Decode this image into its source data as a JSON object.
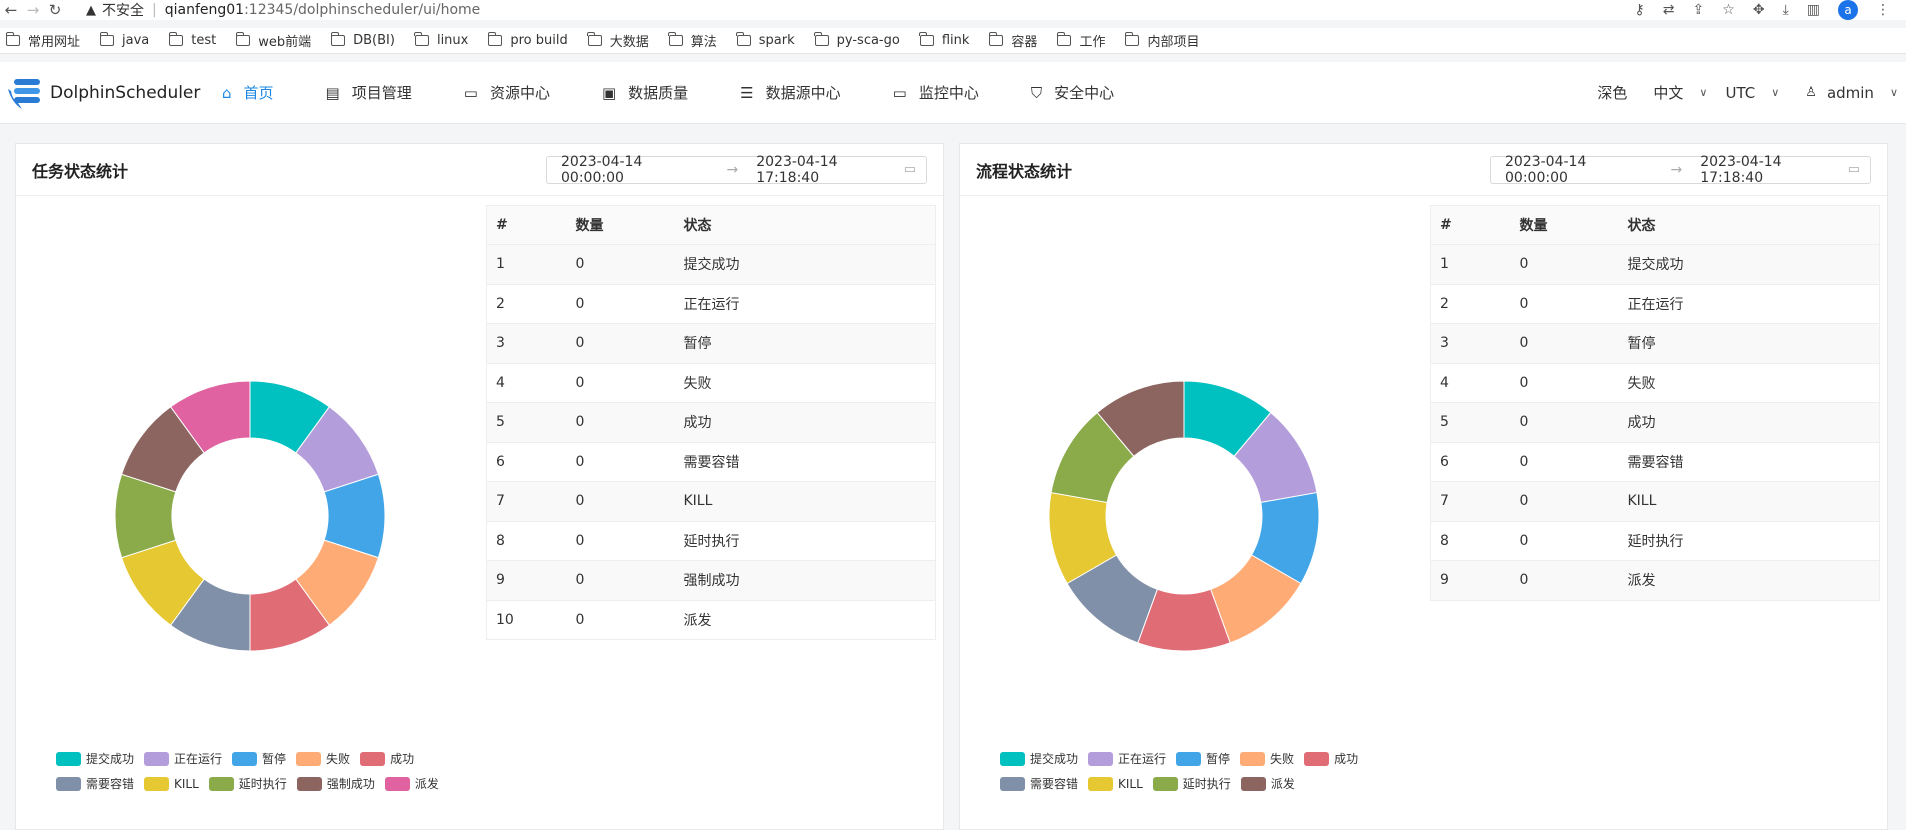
{
  "browser": {
    "security_label": "不安全",
    "url_host": "qianfeng01",
    "url_rest": ":12345/dolphinscheduler/ui/home",
    "profile_initial": "a"
  },
  "bookmarks": [
    "常用网址",
    "java",
    "test",
    "web前端",
    "DB(BI)",
    "linux",
    "pro build",
    "大数据",
    "算法",
    "spark",
    "py-sca-go",
    "flink",
    "容器",
    "工作",
    "内部项目"
  ],
  "app": {
    "name": "DolphinScheduler",
    "menu": [
      {
        "label": "首页",
        "icon": "home-icon"
      },
      {
        "label": "项目管理",
        "icon": "project-icon"
      },
      {
        "label": "资源中心",
        "icon": "folder-icon"
      },
      {
        "label": "数据质量",
        "icon": "data-quality-icon"
      },
      {
        "label": "数据源中心",
        "icon": "datasource-icon"
      },
      {
        "label": "监控中心",
        "icon": "monitor-icon"
      },
      {
        "label": "安全中心",
        "icon": "shield-icon"
      }
    ],
    "theme_label": "深色",
    "language": "中文",
    "timezone": "UTC",
    "user": "admin"
  },
  "task_panel": {
    "title": "任务状态统计",
    "start": "2023-04-14 00:00:00",
    "end": "2023-04-14 17:18:40",
    "headers": [
      "#",
      "数量",
      "状态"
    ],
    "rows": [
      [
        "1",
        "0",
        "提交成功"
      ],
      [
        "2",
        "0",
        "正在运行"
      ],
      [
        "3",
        "0",
        "暂停"
      ],
      [
        "4",
        "0",
        "失败"
      ],
      [
        "5",
        "0",
        "成功"
      ],
      [
        "6",
        "0",
        "需要容错"
      ],
      [
        "7",
        "0",
        "KILL"
      ],
      [
        "8",
        "0",
        "延时执行"
      ],
      [
        "9",
        "0",
        "强制成功"
      ],
      [
        "10",
        "0",
        "派发"
      ]
    ],
    "legend": [
      "提交成功",
      "正在运行",
      "暂停",
      "失败",
      "成功",
      "需要容错",
      "KILL",
      "延时执行",
      "强制成功",
      "派发"
    ]
  },
  "process_panel": {
    "title": "流程状态统计",
    "start": "2023-04-14 00:00:00",
    "end": "2023-04-14 17:18:40",
    "headers": [
      "#",
      "数量",
      "状态"
    ],
    "rows": [
      [
        "1",
        "0",
        "提交成功"
      ],
      [
        "2",
        "0",
        "正在运行"
      ],
      [
        "3",
        "0",
        "暂停"
      ],
      [
        "4",
        "0",
        "失败"
      ],
      [
        "5",
        "0",
        "成功"
      ],
      [
        "6",
        "0",
        "需要容错"
      ],
      [
        "7",
        "0",
        "KILL"
      ],
      [
        "8",
        "0",
        "延时执行"
      ],
      [
        "9",
        "0",
        "派发"
      ]
    ],
    "legend": [
      "提交成功",
      "正在运行",
      "暂停",
      "失败",
      "成功",
      "需要容错",
      "KILL",
      "延时执行",
      "派发"
    ]
  },
  "colors": [
    "#00c0c0",
    "#b39ddb",
    "#42a5e8",
    "#ffab76",
    "#e06c75",
    "#8090a8",
    "#e6c832",
    "#8bab4a",
    "#8d6560",
    "#e062a0"
  ],
  "accent": "#1e88e5"
}
